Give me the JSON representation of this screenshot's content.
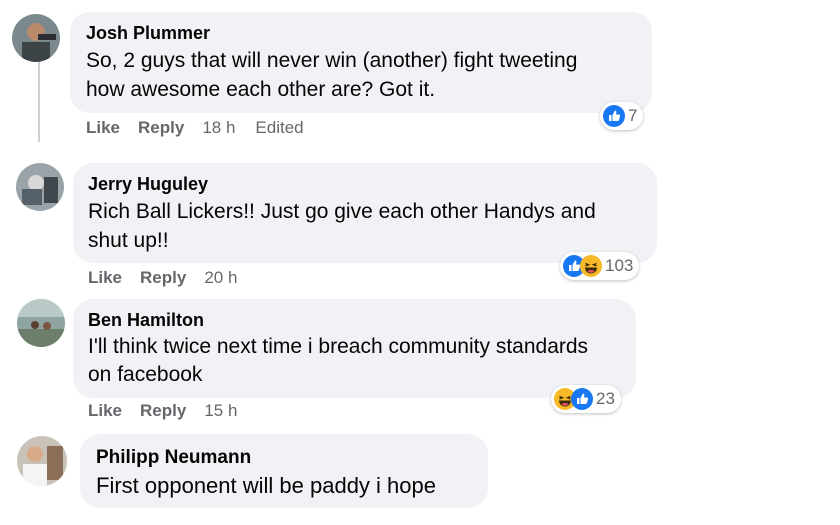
{
  "comments": [
    {
      "author": "Josh Plummer",
      "text_lines": [
        "So, 2 guys that will never win (another) fight tweeting",
        "how awesome each other are? Got it."
      ],
      "actions": {
        "like": "Like",
        "reply": "Reply",
        "time": "18 h",
        "edited": "Edited"
      },
      "reactions": {
        "icons": [
          "like-icon"
        ],
        "count": "7"
      }
    },
    {
      "author": "Jerry Huguley",
      "text_lines": [
        "Rich Ball Lickers!! Just go give each other Handys and",
        "shut up!!"
      ],
      "actions": {
        "like": "Like",
        "reply": "Reply",
        "time": "20 h"
      },
      "reactions": {
        "icons": [
          "like-icon",
          "haha-icon"
        ],
        "count": "103"
      }
    },
    {
      "author": "Ben Hamilton",
      "text_lines": [
        "I'll think twice next time i breach community standards",
        "on facebook"
      ],
      "actions": {
        "like": "Like",
        "reply": "Reply",
        "time": "15 h"
      },
      "reactions": {
        "icons": [
          "haha-icon",
          "like-icon"
        ],
        "count": "23"
      }
    },
    {
      "author": "Philipp Neumann",
      "text_lines": [
        "First opponent will be paddy i hope"
      ]
    }
  ],
  "colors": {
    "like_blue": "#1877f2",
    "haha_yellow": "#f7b928",
    "bubble_bg": "#f0f2f5",
    "meta_gray": "#65676b"
  }
}
